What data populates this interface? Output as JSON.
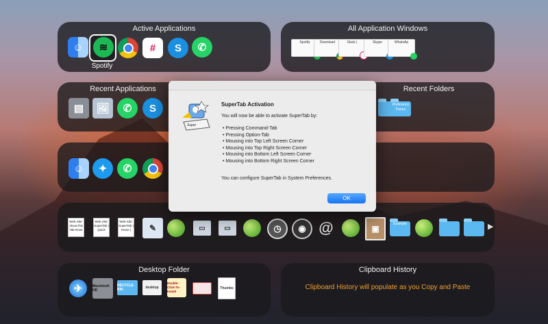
{
  "panels": {
    "active_apps": {
      "title": "Active Applications",
      "selected_label": "Spotify"
    },
    "all_windows": {
      "title": "All Application Windows",
      "windows": [
        "Spotify",
        "Download",
        "Slack |",
        "Skype",
        "WhatsAp"
      ]
    },
    "recent_apps": {
      "title": "Recent Applications"
    },
    "recent_folders": {
      "title": "Recent Folders",
      "folder_label": "Preference Panes"
    },
    "files_row": {
      "docs": [
        "Web Site: About this Tab Rose",
        "Web Site: SuperTab | Quick",
        "Web Site: SuperTab | Home |"
      ],
      "more_arrow": "▶",
      "folder_label": "Example"
    },
    "desktop_folder": {
      "title": "Desktop Folder",
      "items": [
        "Macintosh HD",
        "RECYCLE BIN",
        "desktop",
        "Double-Click-To-Install",
        "Thumbs"
      ]
    },
    "clipboard_history": {
      "title": "Clipboard History",
      "empty_text": "Clipboard History will populate as you Copy and Paste"
    }
  },
  "dialog": {
    "title": "SuperTab Activation",
    "intro": "You will now be able to activate SuperTab by:",
    "items": [
      "Pressing Command-Tab",
      "Pressing Option-Tab",
      "Mousing into Top Left Screen Corner",
      "Mousing into Top Right Screen Corner",
      "Mousing into Bottom Left Screen Corner",
      "Mousing into Bottom Right Screen Corner"
    ],
    "footer": "You can configure SuperTab in System Preferences.",
    "ok_label": "OK",
    "logo_text": "Super"
  },
  "colors": {
    "spotify": "#1db954",
    "slack": "#e01e5a",
    "skype": "#1b8fe0",
    "whatsapp": "#25d366",
    "chrome_red": "#db4437",
    "finder": "#3d8ef0",
    "twitter": "#1d9bf0",
    "clipboard_accent": "#f0a030"
  },
  "icons": [
    "finder-icon",
    "spotify-icon",
    "chrome-icon",
    "slack-icon",
    "skype-icon",
    "whatsapp-icon",
    "twitter-icon",
    "folder-icon",
    "clock-icon",
    "at-icon",
    "green-ball-icon",
    "safari-icon",
    "harddrive-icon"
  ]
}
